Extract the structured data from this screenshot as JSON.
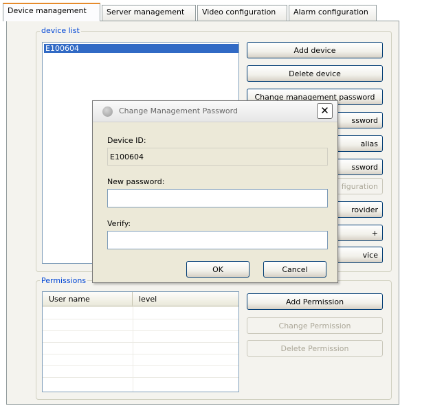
{
  "tabs": [
    {
      "label": "Device management"
    },
    {
      "label": "Server management"
    },
    {
      "label": "Video configuration"
    },
    {
      "label": "Alarm configuration"
    }
  ],
  "device_list": {
    "legend": "device list",
    "items": [
      {
        "label": "E100604",
        "selected": true
      }
    ]
  },
  "device_buttons": {
    "add_device": "Add device",
    "delete_device": "Delete device",
    "change_management_password": "Change management password",
    "b4": "ssword",
    "b5": "alias",
    "b6": "ssword",
    "b7": "figuration",
    "b8": "rovider",
    "b9": "+",
    "b10": "vice"
  },
  "permissions": {
    "legend": "Permissions",
    "columns": [
      "User name",
      "level"
    ],
    "rows": [],
    "add_label": "Add Permission",
    "change_label": "Change Permission",
    "delete_label": "Delete Permission"
  },
  "dialog": {
    "title": "Change Management Password",
    "close_glyph": "✕",
    "device_id_label": "Device ID:",
    "device_id_value": "E100604",
    "new_password_label": "New password:",
    "new_password_value": "",
    "verify_label": "Verify:",
    "verify_value": "",
    "ok_label": "OK",
    "cancel_label": "Cancel"
  },
  "colors": {
    "selection": "#316ac5",
    "group_legend": "#0046d5",
    "active_tab_accent": "#e68b2c"
  }
}
